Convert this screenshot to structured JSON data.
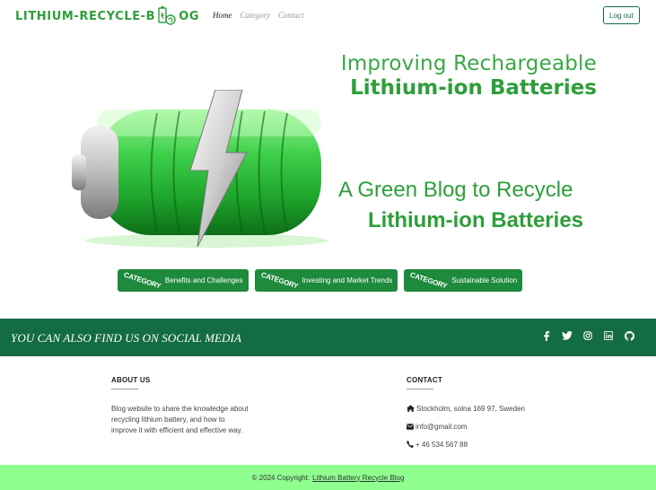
{
  "nav": {
    "logo_text": "LITHIUM-RECYCLE-B",
    "logo_tail": "OG",
    "links": [
      "Home",
      "Category",
      "Contact"
    ],
    "logout": "Log out"
  },
  "hero": {
    "line1": "Improving Rechargeable",
    "line2": "Lithium-ion Batteries",
    "line3": "A Green Blog to Recycle",
    "line4": "Lithium-ion Batteries"
  },
  "categories": {
    "tag": "CATEGORY",
    "items": [
      "Benefits and Challenges",
      "Investing and Market Trends",
      "Sustainable Solution"
    ]
  },
  "social": {
    "text": "YOU CAN ALSO FIND US ON SOCIAL MEDIA",
    "icons": [
      "facebook-icon",
      "twitter-icon",
      "instagram-icon",
      "linkedin-icon",
      "github-icon"
    ]
  },
  "footer": {
    "about_title": "ABOUT US",
    "about_text": "Blog website to share the knowledge about recycling lithium battery, and how to improve it with efficient and effective way.",
    "contact_title": "CONTACT",
    "address": "Stockholm, solna 169 97, Sweden",
    "email": "info@gmail.com",
    "phone": "+ 46 534 567 88"
  },
  "copyright": {
    "prefix": "© 2024 Copyright:",
    "link": "Lithium Battery Recycle Blog"
  },
  "colors": {
    "accent_green": "#2e9e3a",
    "dark_green": "#146c43",
    "light_green": "#8fff8f"
  }
}
